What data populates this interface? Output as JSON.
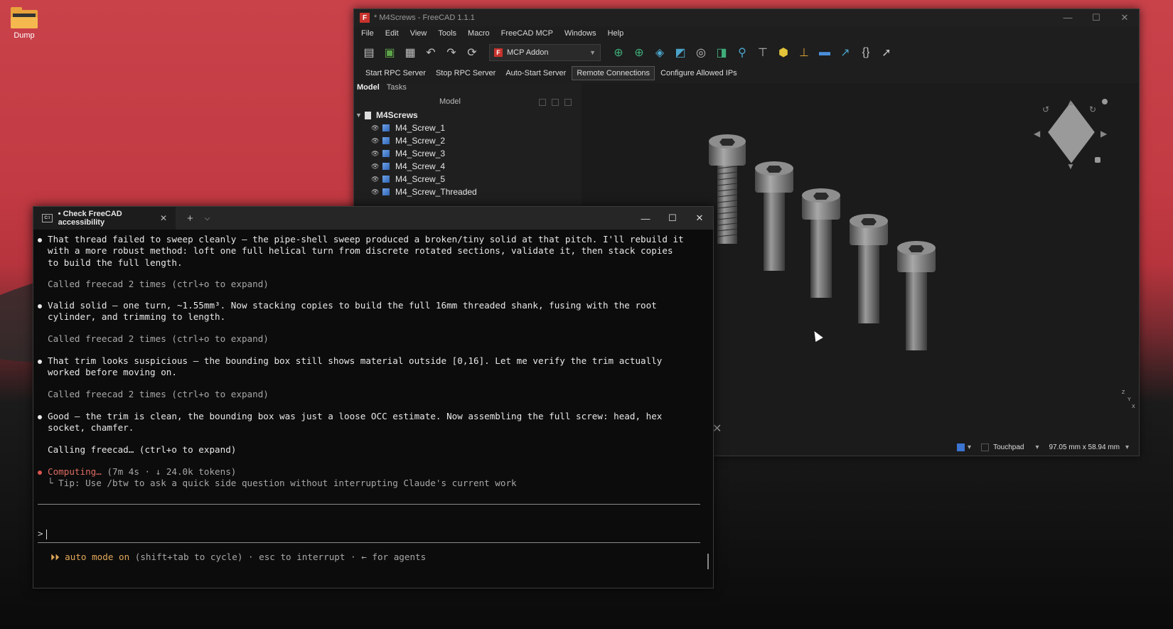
{
  "desktop": {
    "icon_label": "Dump"
  },
  "freecad": {
    "title": "* M4Screws - FreeCAD 1.1.1",
    "window_controls": [
      "—",
      "☐",
      "✕"
    ],
    "menu": [
      "File",
      "Edit",
      "View",
      "Tools",
      "Macro",
      "FreeCAD MCP",
      "Windows",
      "Help"
    ],
    "workbench": "MCP Addon",
    "mcp_buttons": [
      "Start RPC Server",
      "Stop RPC Server",
      "Auto-Start Server",
      "Remote Connections",
      "Configure Allowed IPs"
    ],
    "combo_tabs": [
      "Model",
      "Tasks"
    ],
    "tree_header": "Model",
    "tree_root": "M4Screws",
    "tree_items": [
      "M4_Screw_1",
      "M4_Screw_2",
      "M4_Screw_3",
      "M4_Screw_4",
      "M4_Screw_5",
      "M4_Screw_Threaded"
    ],
    "status": {
      "nav": "Touchpad",
      "dims": "97.05 mm x 58.94 mm"
    }
  },
  "terminal": {
    "tab_title": "• Check FreeCAD accessibility",
    "blocks": [
      {
        "text": "That thread failed to sweep cleanly — the pipe-shell sweep produced a broken/tiny solid at that pitch. I'll rebuild it\nwith a more robust method: loft one full helical turn from discrete rotated sections, validate it, then stack copies\nto build the full length."
      },
      {
        "text": "Called freecad 2 times (ctrl+o to expand)"
      },
      {
        "text": "Valid solid — one turn, ~1.55mm³. Now stacking copies to build the full 16mm threaded shank, fusing with the root\ncylinder, and trimming to length."
      },
      {
        "text": "Called freecad 2 times (ctrl+o to expand)"
      },
      {
        "text": "That trim looks suspicious — the bounding box still shows material outside [0,16]. Let me verify the trim actually\nworked before moving on."
      },
      {
        "text": "Called freecad 2 times (ctrl+o to expand)"
      },
      {
        "text": "Good — the trim is clean, the bounding box was just a loose OCC estimate. Now assembling the full screw: head, hex\nsocket, chamfer."
      },
      {
        "text": "Calling freecad… (ctrl+o to expand)"
      }
    ],
    "status_label": "Computing…",
    "status_detail": " (7m 4s · ↓ 24.0k tokens)",
    "tip": "└ Tip: Use /btw to ask a quick side question without interrupting Claude's current work",
    "prompt": ">",
    "footer_mode": "⏵⏵ auto mode on",
    "footer_rest": " (shift+tab to cycle) · esc to interrupt · ← for agents"
  }
}
